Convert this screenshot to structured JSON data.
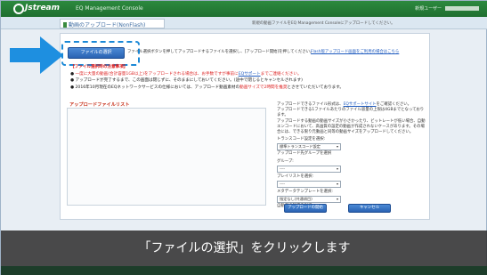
{
  "header": {
    "brand": "Jstream",
    "console_title": "EQ Management Console",
    "user_prefix": "新規ユーザー"
  },
  "subheader": {
    "page_title": "動画のアップロード(NonFlash)",
    "info": "新規の動画ファイルをEQ Management Consoleにアップロードしてください。"
  },
  "toolbar": {
    "select_button": "ファイルの選択",
    "description": "ファイル選択ボタンを押してアップロードするファイルを選択し、[アップロード開始]を押してください。",
    "help_link": "Flash版アップロード画面をご利用の場合はこちら"
  },
  "notice": {
    "heading": "【ファイル選択時の注意事項】",
    "line1_a": "一度に大量の動画(合計容量1GB以上)をアップロードされる場合は、お手数ですが事前に",
    "line1_link": "EQサポート",
    "line1_b": "までご連絡ください。",
    "line2": "アップロードが完了するまで、この画面は閉じずに、そのままにしておいてください。(途中で閉じるとキャンセルされます)",
    "line3_a": "2016年10月現在のEQネットワークサービスの仕様においては、アップロード動画素材の",
    "line3_r": "動画サイズで2時間を推奨",
    "line3_b": "とさせていただいております。"
  },
  "upload_list": {
    "title": "アップロードファイルリスト"
  },
  "right_panel": {
    "p1_a": "アップロードできるファイル形式は、",
    "p1_link": "EQサポートサイト",
    "p1_b": "をご確認ください。",
    "p2": "アップロードできる1ファイルあたりのファイル容量の上限は4GBまでとなっております。",
    "p3": "アップロードする動画の動画サイズが小さかったり、ビットレートが低い場合、自動エンコードにおいて、高画質の設定の動画が作成されないケースがあります。その場合には、できる限り元動画と同等の動画サイズをアップロードしてください。",
    "transcode_label": "トランスコード設定を選択:",
    "transcode_options": [
      "標準トランスコード設定",
      "アップロード先グループを選択"
    ],
    "group_label": "グループ:",
    "group_value": "----",
    "playlist_label": "プレイリストを選択:",
    "playlist_value": "----",
    "meta_label": "メタデータテンプレートを選択:",
    "meta_value": "指定なし(共通項目)",
    "auto_label": "自動変換設定を利用",
    "start_button": "アップロードの開始",
    "cancel_button": "キャンセル"
  },
  "caption": "「ファイルの選択」をクリックします",
  "colors": {
    "header_green": "#2c8a3e",
    "accent_blue": "#1a88d6",
    "warning_red": "#d22"
  }
}
